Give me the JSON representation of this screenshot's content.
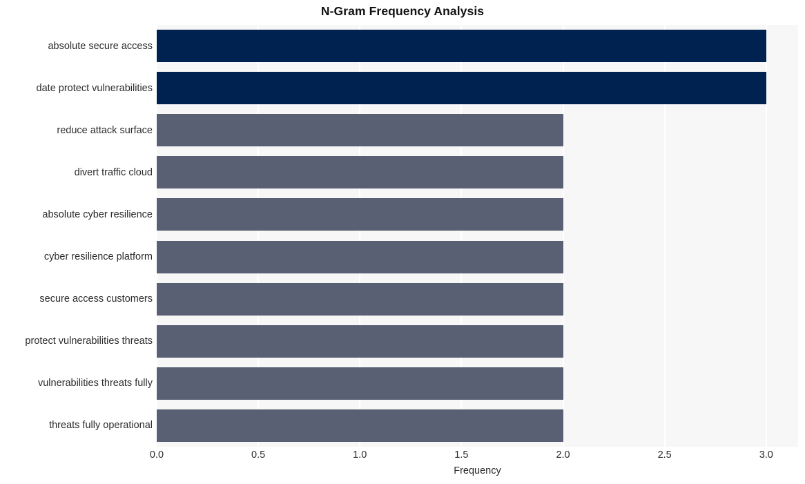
{
  "chart_data": {
    "type": "bar",
    "orientation": "horizontal",
    "title": "N-Gram Frequency Analysis",
    "xlabel": "Frequency",
    "ylabel": "",
    "categories": [
      "absolute secure access",
      "date protect vulnerabilities",
      "reduce attack surface",
      "divert traffic cloud",
      "absolute cyber resilience",
      "cyber resilience platform",
      "secure access customers",
      "protect vulnerabilities threats",
      "vulnerabilities threats fully",
      "threats fully operational"
    ],
    "values": [
      3,
      3,
      2,
      2,
      2,
      2,
      2,
      2,
      2,
      2
    ],
    "bar_colors": [
      "#002250",
      "#002250",
      "#5a6074",
      "#5a6074",
      "#5a6074",
      "#5a6074",
      "#5a6074",
      "#5a6074",
      "#5a6074",
      "#5a6074"
    ],
    "xlim": [
      0.0,
      3.157
    ],
    "xticks": [
      0.0,
      0.5,
      1.0,
      1.5,
      2.0,
      2.5,
      3.0
    ],
    "xticklabels": [
      "0.0",
      "0.5",
      "1.0",
      "1.5",
      "2.0",
      "2.5",
      "3.0"
    ],
    "grid": true,
    "grid_axis": "x",
    "grid_color": "#ffffff",
    "plot_background": "#f7f7f8",
    "figure_background": "#ffffff",
    "legend": null,
    "legend_position": "none",
    "highlight_color": "#002250",
    "base_color": "#5a6074",
    "text_color": "#2b2b2b",
    "title_color": "#111111"
  }
}
